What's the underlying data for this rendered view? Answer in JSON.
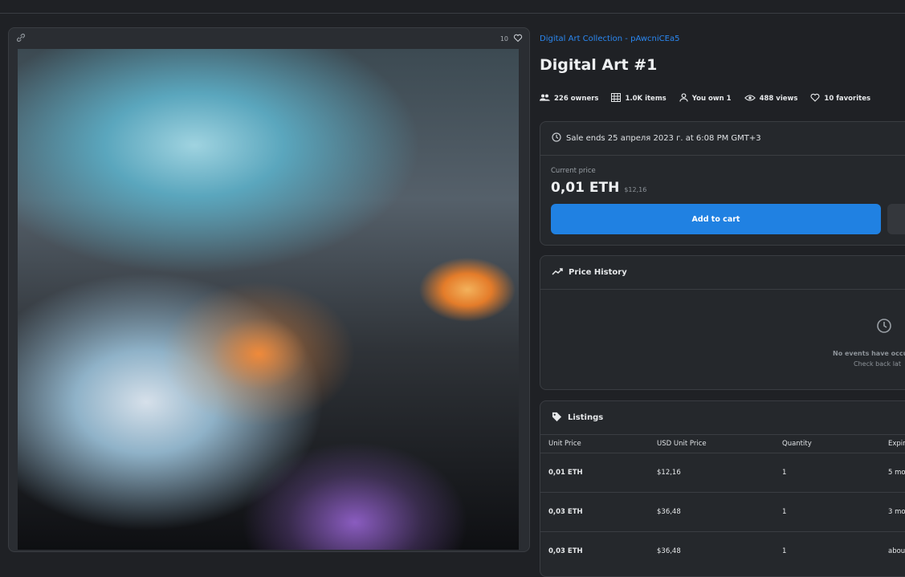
{
  "media": {
    "favorites_count": "10"
  },
  "collection_link": "Digital Art Collection - pAwcniCEa5",
  "title": "Digital Art #1",
  "stats": {
    "owners": "226 owners",
    "items": "1.0K items",
    "you_own": "You own 1",
    "views": "488 views",
    "favorites": "10 favorites"
  },
  "sale": {
    "ends_text": "Sale ends 25 апреля 2023 г. at 6:08 PM GMT+3",
    "current_price_label": "Current price",
    "price_eth": "0,01 ETH",
    "price_usd": "$12,16",
    "add_to_cart_label": "Add to cart"
  },
  "price_history": {
    "title": "Price History",
    "empty_title": "No events have occu",
    "empty_sub": "Check back lat"
  },
  "listings": {
    "title": "Listings",
    "headers": [
      "Unit Price",
      "USD Unit Price",
      "Quantity",
      "Expir"
    ],
    "rows": [
      [
        "0,01 ETH",
        "$12,16",
        "1",
        "5 mo"
      ],
      [
        "0,03 ETH",
        "$36,48",
        "1",
        "3 mo"
      ],
      [
        "0,03 ETH",
        "$36,48",
        "1",
        "abou"
      ]
    ]
  },
  "colors": {
    "accent": "#2081e2",
    "link": "#2b88f2",
    "background": "#1f2125",
    "panel": "#25282c"
  },
  "icons": [
    "link-icon",
    "heart-icon",
    "owners-icon",
    "grid-icon",
    "person-icon",
    "eye-icon",
    "clock-icon",
    "trend-icon",
    "tag-icon"
  ]
}
